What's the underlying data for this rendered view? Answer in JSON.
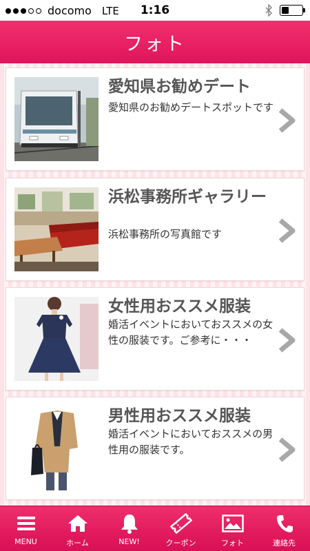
{
  "status_bar": {
    "carrier": "docomo",
    "network": "LTE",
    "time": "1:16",
    "signal_bars_filled": 3,
    "signal_bars_total": 5,
    "battery_level": 0.35,
    "bluetooth_icon": "bluetooth-icon"
  },
  "header": {
    "title": "フォト"
  },
  "photo_list": {
    "items": [
      {
        "title": "愛知県お勧めデート",
        "description": "愛知県のお勧めデートスポットです",
        "thumbnail": "tram-photo"
      },
      {
        "title": "浜松事務所ギャラリー",
        "description": "浜松事務所の写真館です",
        "thumbnail": "office-interior-photo"
      },
      {
        "title": "女性用おススメ服装",
        "description": "婚活イベントにおいておススメの女性の服装です。ご参考に・・・",
        "thumbnail": "navy-dress-photo"
      },
      {
        "title": "男性用おススメ服装",
        "description": "婚活イベントにおいておススメの男性用の服装です。",
        "thumbnail": "mens-jacket-photo"
      }
    ]
  },
  "tabbar": {
    "items": [
      {
        "label": "MENU",
        "icon": "menu-icon"
      },
      {
        "label": "ホーム",
        "icon": "home-icon"
      },
      {
        "label": "NEW!",
        "icon": "bell-icon"
      },
      {
        "label": "クーポン",
        "icon": "coupon-icon"
      },
      {
        "label": "フォト",
        "icon": "photo-icon"
      },
      {
        "label": "連絡先",
        "icon": "phone-icon"
      }
    ]
  },
  "colors": {
    "accent": "#e0145a",
    "title_gray": "#555555",
    "chevron_gray": "#a8a8a8"
  }
}
